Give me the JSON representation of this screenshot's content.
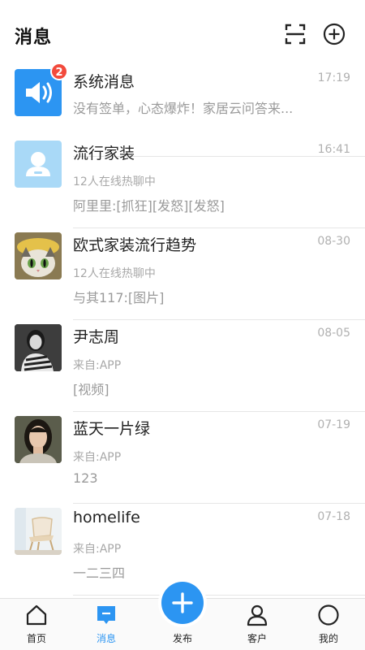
{
  "header": {
    "title": "消息"
  },
  "messages": [
    {
      "name": "系统消息",
      "time": "17:19",
      "badge": "2",
      "sub": "",
      "preview": "没有签单，心态爆炸！家居云问答来..."
    },
    {
      "name": "流行家装",
      "time": "16:41",
      "badge": "",
      "sub": "12人在线热聊中",
      "preview": "阿里里:[抓狂][发怒][发怒]"
    },
    {
      "name": "欧式家装流行趋势",
      "time": "08-30",
      "badge": "",
      "sub": "12人在线热聊中",
      "preview": "与其117:[图片]"
    },
    {
      "name": "尹志周",
      "time": "08-05",
      "badge": "",
      "sub": "来自:APP",
      "preview": "[视频]"
    },
    {
      "name": "蓝天一片绿",
      "time": "07-19",
      "badge": "",
      "sub": "来自:APP",
      "preview": "123"
    },
    {
      "name": "homelife",
      "time": "07-18",
      "badge": "",
      "sub": "来自:APP",
      "preview": "一二三四"
    }
  ],
  "tabbar": {
    "items": [
      {
        "label": "首页",
        "icon": "home-icon",
        "active": false
      },
      {
        "label": "消息",
        "icon": "message-icon",
        "active": true
      },
      {
        "label": "发布",
        "icon": "plus-icon",
        "active": false
      },
      {
        "label": "客户",
        "icon": "person-icon",
        "active": false
      },
      {
        "label": "我的",
        "icon": "circle-icon",
        "active": false
      }
    ]
  },
  "colors": {
    "accent": "#2c95f2",
    "badge": "#f24a3c",
    "divider": "#e6e6e6"
  }
}
